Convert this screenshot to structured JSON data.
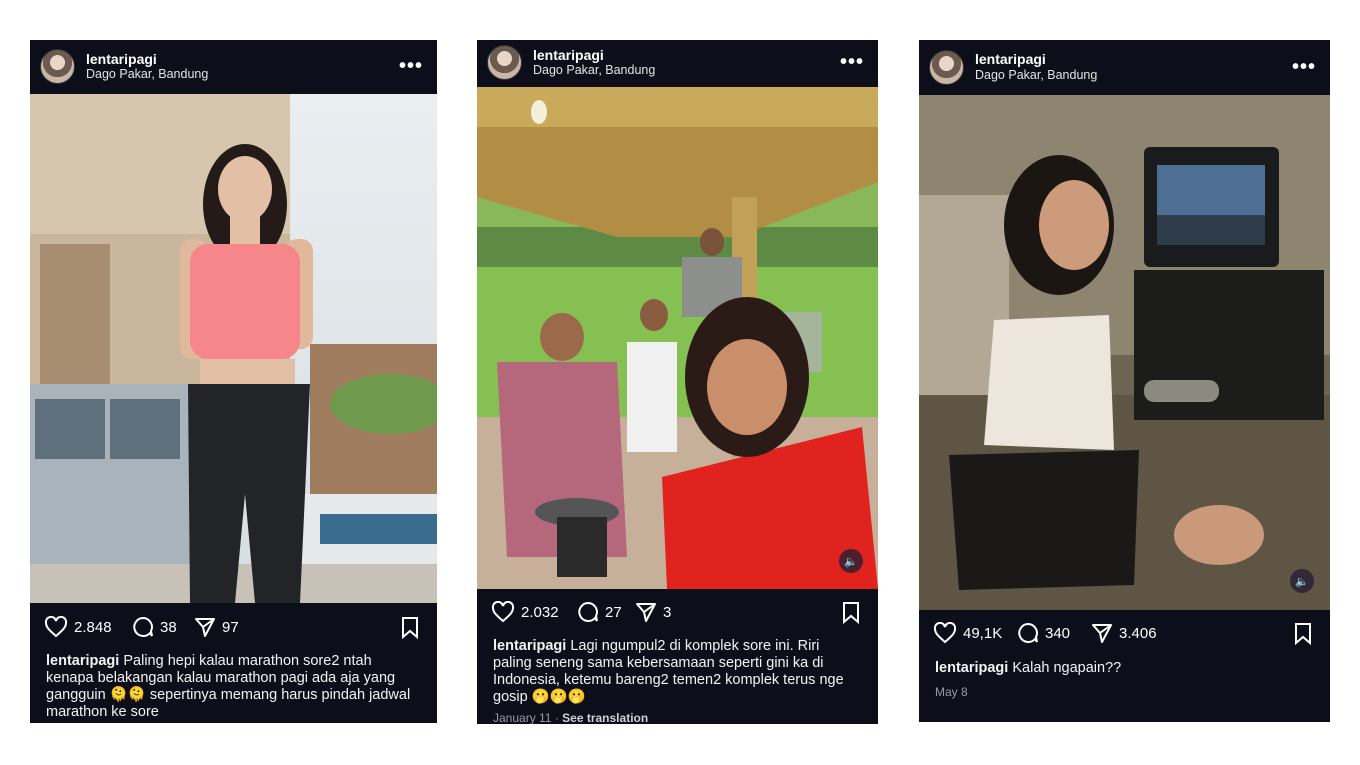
{
  "posts": [
    {
      "username": "lentaripagi",
      "location": "Dago Pakar, Bandung",
      "likes": "2.848",
      "comments": "38",
      "shares": "97",
      "caption_user": "lentaripagi",
      "caption_text": "Paling hepi kalau marathon sore2 ntah kenapa belakangan kalau marathon pagi ada aja yang gangguin 🫠🫠 sepertinya memang harus pindah jadwal marathon ke sore"
    },
    {
      "username": "lentaripagi",
      "location": "Dago Pakar, Bandung",
      "likes": "2.032",
      "comments": "27",
      "shares": "3",
      "caption_user": "lentaripagi",
      "caption_text": "Lagi ngumpul2 di komplek sore ini. Riri paling seneng sama kebersamaan seperti gini ka di Indonesia, ketemu bareng2 temen2 komplek terus nge gosip 🫢🫢🫢",
      "date": "January 11",
      "translation": "See translation"
    },
    {
      "username": "lentaripagi",
      "location": "Dago Pakar, Bandung",
      "likes": "49,1K",
      "comments": "340",
      "shares": "3.406",
      "caption_user": "lentaripagi",
      "caption_text": "Kalah ngapain??",
      "date": "May 8"
    }
  ],
  "icons": {
    "like": "heart-icon",
    "comment": "comment-icon",
    "share": "send-icon",
    "save": "bookmark-icon",
    "more": "more-options-icon",
    "sound": "speaker-icon"
  },
  "colors": {
    "post_background": "#0c0f1a",
    "page_background": "#ffffff",
    "text": "#ffffff",
    "meta_text": "#9a9aa2"
  }
}
